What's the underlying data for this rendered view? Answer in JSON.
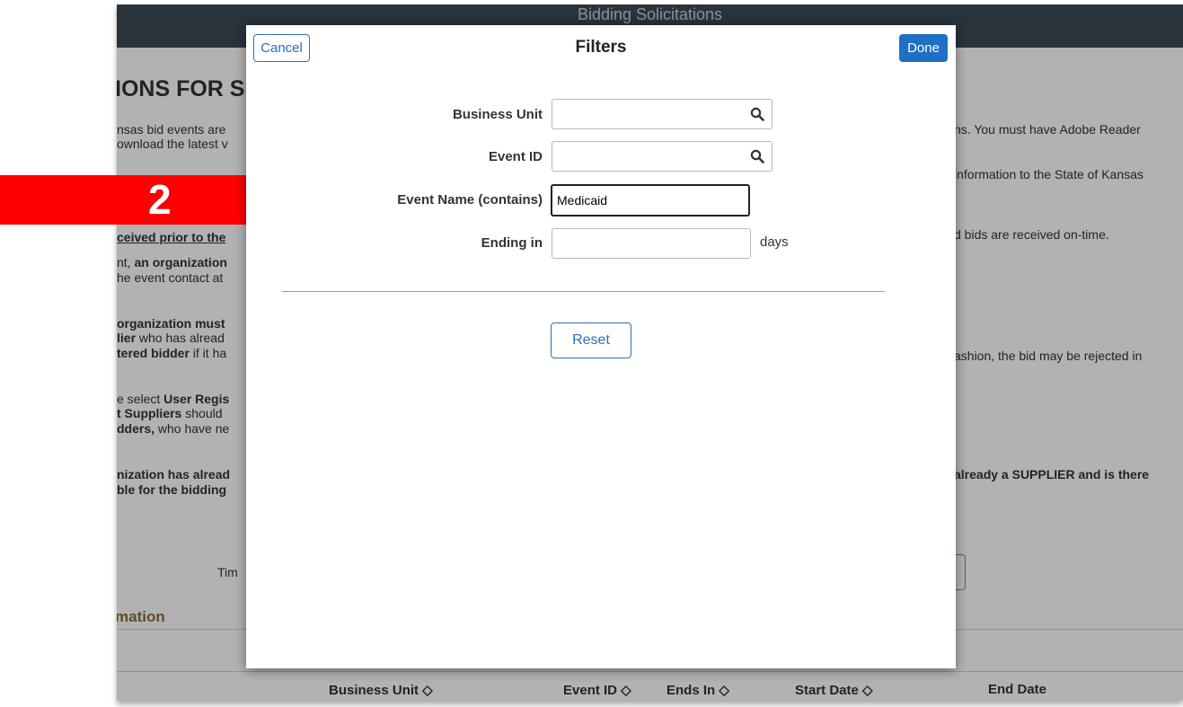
{
  "background": {
    "header_title": "Bidding Solicitations",
    "heading": "IONS FOR S",
    "lines_left": [
      {
        "id": "l1",
        "text": "nsas bid events are"
      },
      {
        "id": "l2",
        "text": "ownload the latest v"
      },
      {
        "id": "l3",
        "text": "ceived prior to the"
      },
      {
        "id": "l4a",
        "text": "nt, "
      },
      {
        "id": "l4b",
        "text": "an organization"
      },
      {
        "id": "l5",
        "text": "he event contact at"
      },
      {
        "id": "l6",
        "text": "organization must"
      },
      {
        "id": "l7a",
        "text": "lier"
      },
      {
        "id": "l7b",
        "text": " who has alread"
      },
      {
        "id": "l8a",
        "text": "tered bidder"
      },
      {
        "id": "l8b",
        "text": " if it ha"
      },
      {
        "id": "l9a",
        "text": "e select "
      },
      {
        "id": "l9b",
        "text": "User Regis"
      },
      {
        "id": "l10a",
        "text": "t Suppliers"
      },
      {
        "id": "l10b",
        "text": " should"
      },
      {
        "id": "l11a",
        "text": "dders,"
      },
      {
        "id": "l11b",
        "text": " who have ne"
      },
      {
        "id": "l12",
        "text": "nization has alread"
      },
      {
        "id": "l13",
        "text": "ble for the bidding"
      },
      {
        "id": "l14",
        "text": "Tim"
      }
    ],
    "lines_right": [
      {
        "id": "r1",
        "text": "ns. You must have Adobe Reader"
      },
      {
        "id": "r2",
        "text": "information to the State of Kansas"
      },
      {
        "id": "r3",
        "text": "d bids are received on-time."
      },
      {
        "id": "r4",
        "text": "ashion, the bid may be rejected in"
      },
      {
        "id": "r5",
        "text": "already a SUPPLIER and is there"
      }
    ],
    "section_title": "mation",
    "table_headers": {
      "business_unit": "Business Unit ◇",
      "event_id": "Event ID ◇",
      "ends_in": "Ends In ◇",
      "start_date": "Start Date ◇",
      "end_date": "End Date"
    }
  },
  "callout": {
    "number": "2",
    "color": "#ff0000"
  },
  "modal": {
    "title": "Filters",
    "cancel_label": "Cancel",
    "done_label": "Done",
    "fields": {
      "business_unit": {
        "label": "Business Unit",
        "value": ""
      },
      "event_id": {
        "label": "Event ID",
        "value": ""
      },
      "event_name": {
        "label": "Event Name (contains)",
        "value": "Medicaid"
      },
      "ending_in": {
        "label": "Ending in",
        "value": "",
        "suffix": "days"
      }
    },
    "reset_label": "Reset"
  },
  "colors": {
    "accent": "#1f6fc5",
    "header": "#3c4a57"
  }
}
